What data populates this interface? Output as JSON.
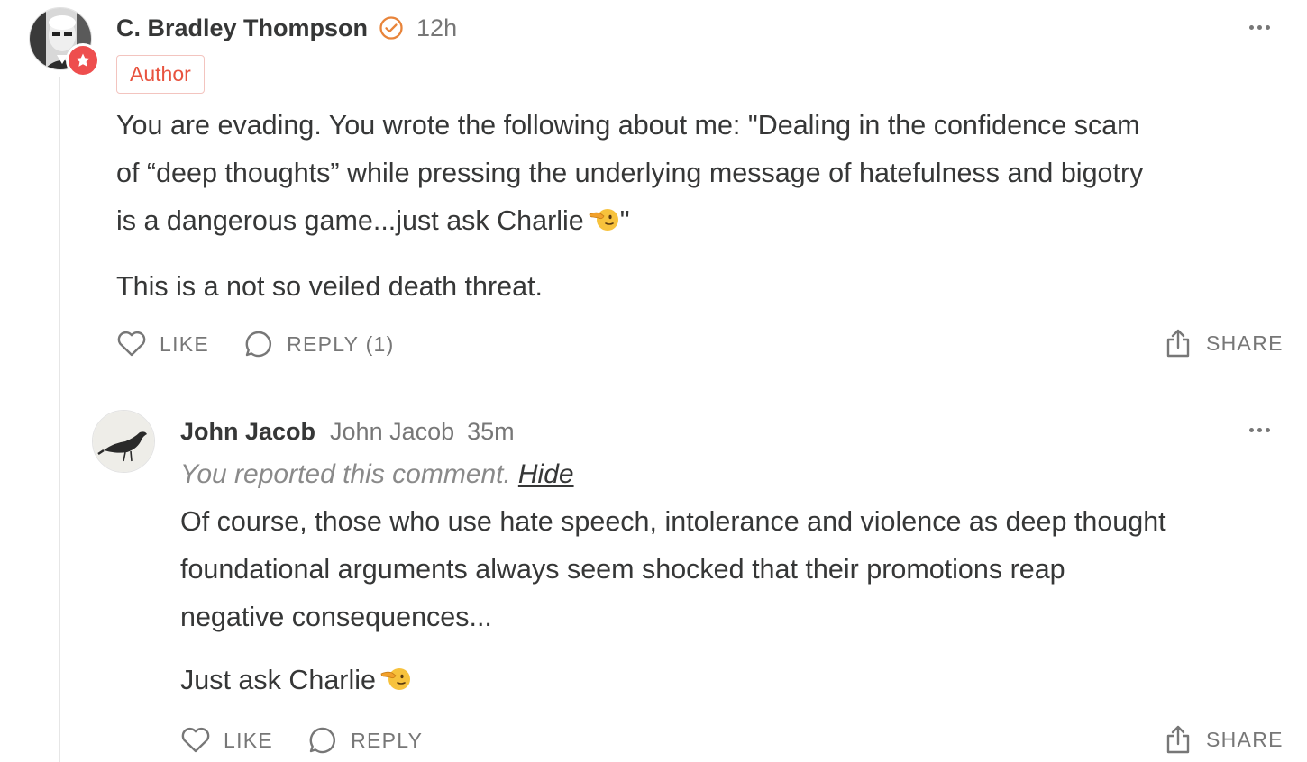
{
  "comment": {
    "author": "C. Bradley Thompson",
    "time": "12h",
    "badge": "Author",
    "body_lines": [
      "You are evading. You wrote the following about me: \"Dealing in the confidence scam",
      "of “deep thoughts” while pressing the underlying message of hatefulness and bigotry",
      "is a dangerous game...just ask Charlie"
    ],
    "body_line3_suffix": "\"",
    "body_para2": "This is a not so veiled death threat.",
    "actions": {
      "like": "LIKE",
      "reply": "REPLY (1)",
      "share": "SHARE"
    },
    "icons": [
      "heart-icon",
      "speech-bubble-icon",
      "share-icon",
      "more-dots-icon",
      "verified-check-icon",
      "author-star-icon",
      "pointing-emoji-icon"
    ]
  },
  "reply": {
    "author": "John Jacob",
    "handle": "John Jacob",
    "time": "35m",
    "reported_text": "You reported this comment.",
    "hide_label": "Hide",
    "body_lines": [
      "Of course, those who use hate speech, intolerance and violence as deep thought",
      "foundational arguments always seem shocked that their promotions reap",
      "negative consequences..."
    ],
    "body_para2": "Just ask Charlie",
    "actions": {
      "like": "LIKE",
      "reply": "REPLY",
      "share": "SHARE"
    }
  },
  "colors": {
    "text": "#363737",
    "muted": "#777777",
    "accent_orange": "#e8843a",
    "author_red": "#e8533f"
  }
}
